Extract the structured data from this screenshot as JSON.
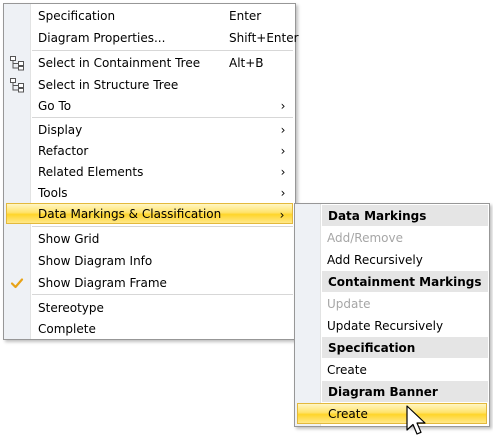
{
  "main_menu": {
    "items": [
      {
        "label": "Specification",
        "shortcut": "Enter"
      },
      {
        "label": "Diagram Properties...",
        "shortcut": "Shift+Enter"
      },
      {
        "label": "Select in Containment Tree",
        "shortcut": "Alt+B",
        "icon": "containment-tree-icon"
      },
      {
        "label": "Select in Structure Tree",
        "icon": "structure-tree-icon"
      },
      {
        "label": "Go To",
        "arrow": "›"
      },
      {
        "label": "Display",
        "arrow": "›"
      },
      {
        "label": "Refactor",
        "arrow": "›"
      },
      {
        "label": "Related Elements",
        "arrow": "›"
      },
      {
        "label": "Tools",
        "arrow": "›"
      },
      {
        "label": "Data Markings & Classification",
        "arrow": "›",
        "highlighted": true
      },
      {
        "label": "Show Grid"
      },
      {
        "label": "Show Diagram Info"
      },
      {
        "label": "Show Diagram Frame",
        "checked": true
      },
      {
        "label": "Stereotype"
      },
      {
        "label": "Complete"
      }
    ]
  },
  "submenu": {
    "items": [
      {
        "label": "Data Markings",
        "type": "section"
      },
      {
        "label": "Add/Remove",
        "disabled": true
      },
      {
        "label": "Add Recursively"
      },
      {
        "label": "Containment Markings",
        "type": "section"
      },
      {
        "label": "Update",
        "disabled": true
      },
      {
        "label": "Update Recursively"
      },
      {
        "label": "Specification",
        "type": "section"
      },
      {
        "label": "Create"
      },
      {
        "label": "Diagram Banner",
        "type": "section"
      },
      {
        "label": "Create",
        "highlighted": true
      }
    ]
  },
  "colors": {
    "highlight": "#ffd529",
    "gutter": "#eef1f5",
    "check": "#e8a317",
    "section_bg": "#e5e5e5",
    "disabled_text": "#a6a6a6"
  }
}
